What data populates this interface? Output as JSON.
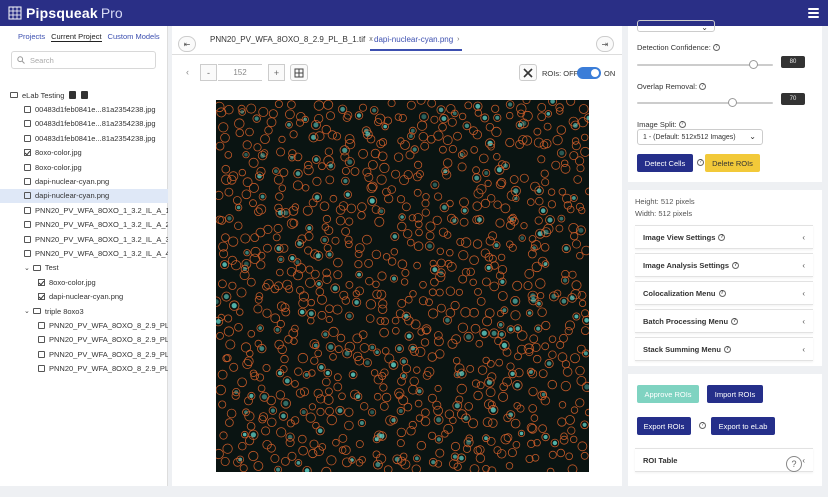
{
  "app": {
    "name": "Pipsqueak",
    "suffix": "Pro"
  },
  "sidebar": {
    "tabs": [
      {
        "label": "Projects"
      },
      {
        "label": "Current Project"
      },
      {
        "label": "Custom Models"
      }
    ],
    "search_placeholder": "Search",
    "tree": [
      {
        "label": "eLab Testing",
        "kind": "root",
        "indent": 0
      },
      {
        "label": "00483d1feb0841e...81a2354238.jpg",
        "kind": "file",
        "indent": 1
      },
      {
        "label": "00483d1feb0841e...81a2354238.jpg",
        "kind": "file",
        "indent": 1
      },
      {
        "label": "00483d1feb0841e...81a2354238.jpg",
        "kind": "file",
        "indent": 1
      },
      {
        "label": "8oxo-color.jpg",
        "kind": "check",
        "indent": 1
      },
      {
        "label": "8oxo-color.jpg",
        "kind": "file",
        "indent": 1
      },
      {
        "label": "dapi-nuclear-cyan.png",
        "kind": "file",
        "indent": 1
      },
      {
        "label": "dapi-nuclear-cyan.png",
        "kind": "file",
        "indent": 1,
        "selected": true
      },
      {
        "label": "PNN20_PV_WFA_8OXO_1_3.2_IL_A_1.tif",
        "kind": "file",
        "indent": 1
      },
      {
        "label": "PNN20_PV_WFA_8OXO_1_3.2_IL_A_2.tif",
        "kind": "file",
        "indent": 1
      },
      {
        "label": "PNN20_PV_WFA_8OXO_1_3.2_IL_A_3.tif",
        "kind": "file",
        "indent": 1
      },
      {
        "label": "PNN20_PV_WFA_8OXO_1_3.2_IL_A_4.tif",
        "kind": "file",
        "indent": 1
      },
      {
        "label": "Test",
        "kind": "folder",
        "indent": 1
      },
      {
        "label": "8oxo-color.jpg",
        "kind": "check",
        "indent": 2
      },
      {
        "label": "dapi-nuclear-cyan.png",
        "kind": "check",
        "indent": 2
      },
      {
        "label": "triple 8oxo3",
        "kind": "folder",
        "indent": 1
      },
      {
        "label": "PNN20_PV_WFA_8OXO_8_2.9_PL_",
        "kind": "file",
        "indent": 2
      },
      {
        "label": "PNN20_PV_WFA_8OXO_8_2.9_PL_",
        "kind": "file",
        "indent": 2
      },
      {
        "label": "PNN20_PV_WFA_8OXO_8_2.9_PL_",
        "kind": "file",
        "indent": 2
      },
      {
        "label": "PNN20_PV_WFA_8OXO_8_2.9_PL_",
        "kind": "file",
        "indent": 2
      }
    ]
  },
  "viewer": {
    "tabs": [
      {
        "label": "PNN20_PV_WFA_8OXO_8_2.9_PL_B_1.tif",
        "close": "x"
      },
      {
        "label": "dapi-nuclear-cyan.png",
        "close": "›"
      }
    ],
    "page_value": "152",
    "roi_toggle": {
      "label": "ROIs: OFF",
      "on_label": "ON",
      "state": "on"
    }
  },
  "panel": {
    "detection_confidence": {
      "label": "Detection Confidence:",
      "value": "80",
      "level": 0.85
    },
    "overlap_removal": {
      "label": "Overlap Removal:",
      "value": "70",
      "level": 0.7
    },
    "image_split": {
      "label": "Image Split:",
      "selected": "1 - (Default: 512x512 Images)"
    },
    "detect_label": "Detect Cells",
    "delete_label": "Delete ROIs",
    "height_text": "Height: 512 pixels",
    "width_text": "Width: 512 pixels",
    "accordions": [
      {
        "label": "Image View Settings"
      },
      {
        "label": "Image Analysis Settings"
      },
      {
        "label": "Colocalization Menu"
      },
      {
        "label": "Batch Processing Menu"
      },
      {
        "label": "Stack Summing Menu"
      }
    ],
    "approve_label": "Approve ROIs",
    "import_label": "Import ROIs",
    "export_label": "Export ROIs",
    "export_elab_label": "Export to eLab",
    "roi_table_label": "ROI Table",
    "help_fab": "?"
  },
  "colors": {
    "brand": "#2a2f86",
    "roi": "#d5602b",
    "cell": "#5fd0c6"
  }
}
